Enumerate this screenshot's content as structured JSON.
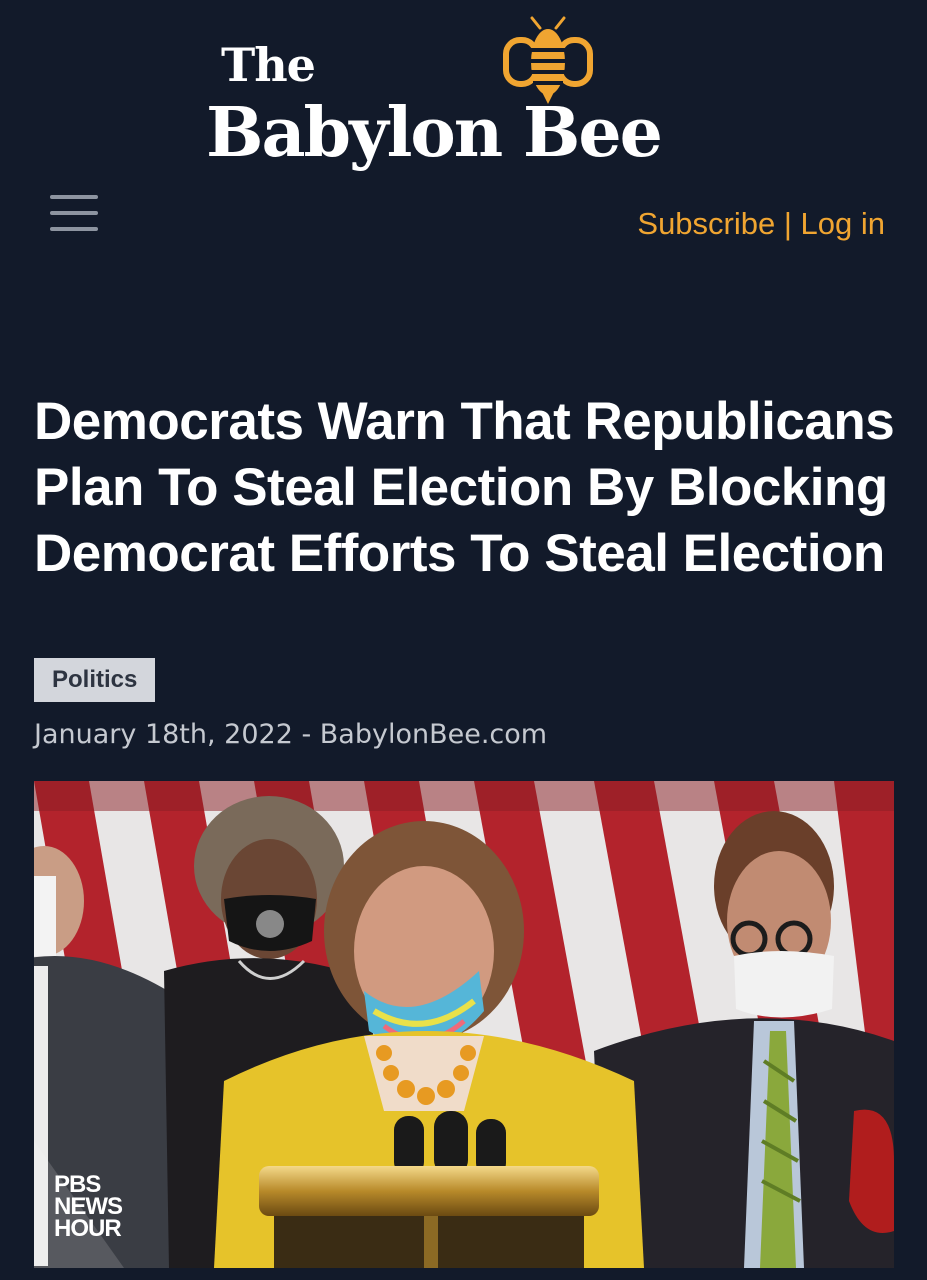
{
  "header": {
    "logo_the": "The",
    "logo_name": "Babylon Bee",
    "menu_icon": "hamburger-menu-icon",
    "subscribe_label": "Subscribe",
    "separator": " | ",
    "login_label": "Log in",
    "accent_color": "#f0a531",
    "background_color": "#121a2a"
  },
  "article": {
    "headline": "Democrats Warn That Republicans Plan To Steal Election By Blocking Democrat Efforts To Steal Election",
    "category": "Politics",
    "byline": "January 18th, 2022 - BabylonBee.com"
  },
  "photo": {
    "watermark_line1": "PBS",
    "watermark_line2": "NEWS",
    "watermark_line3": "HOUR"
  }
}
